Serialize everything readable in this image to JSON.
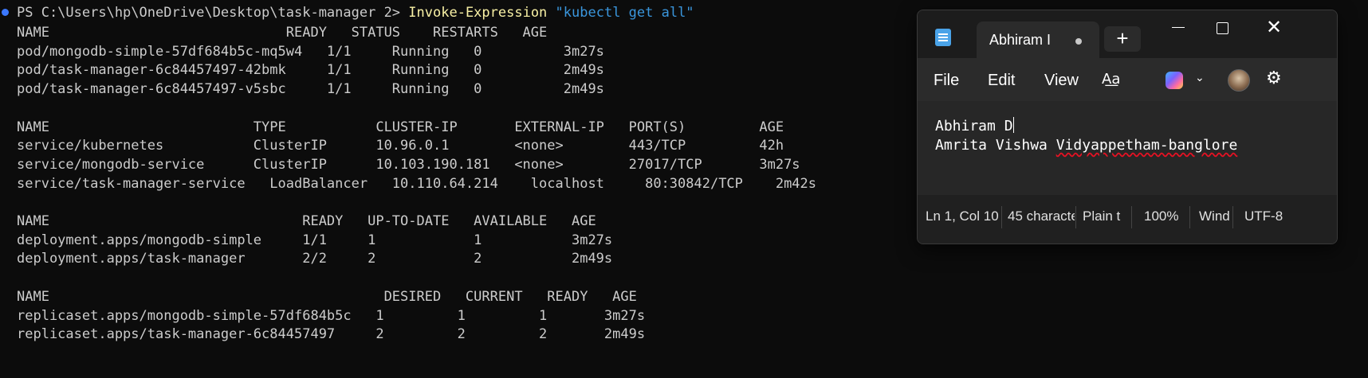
{
  "terminal": {
    "prompt": "PS C:\\Users\\hp\\OneDrive\\Desktop\\task-manager 2>",
    "command": "Invoke-Expression",
    "argument": "\"kubectl get all\"",
    "lines": [
      "NAME                             READY   STATUS    RESTARTS   AGE",
      "pod/mongodb-simple-57df684b5c-mq5w4   1/1     Running   0          3m27s",
      "pod/task-manager-6c84457497-42bmk     1/1     Running   0          2m49s",
      "pod/task-manager-6c84457497-v5sbc     1/1     Running   0          2m49s",
      "",
      "NAME                         TYPE           CLUSTER-IP       EXTERNAL-IP   PORT(S)         AGE",
      "service/kubernetes           ClusterIP      10.96.0.1        <none>        443/TCP         42h",
      "service/mongodb-service      ClusterIP      10.103.190.181   <none>        27017/TCP       3m27s",
      "service/task-manager-service   LoadBalancer   10.110.64.214    localhost     80:30842/TCP    2m42s",
      "",
      "NAME                               READY   UP-TO-DATE   AVAILABLE   AGE",
      "deployment.apps/mongodb-simple     1/1     1            1           3m27s",
      "deployment.apps/task-manager       2/2     2            2           2m49s",
      "",
      "NAME                                         DESIRED   CURRENT   READY   AGE",
      "replicaset.apps/mongodb-simple-57df684b5c   1         1         1       3m27s",
      "replicaset.apps/task-manager-6c84457497     2         2         2       2m49s"
    ]
  },
  "notepad": {
    "tab_title": "Abhiram I",
    "new_tab": "+",
    "menu": {
      "file": "File",
      "edit": "Edit",
      "view": "View"
    },
    "content": {
      "line1": "Abhiram D",
      "line2_prefix": "Amrita Vishwa ",
      "line2_misspelled": "Vidyappetham-banglore"
    },
    "status": {
      "position": "Ln 1, Col 10",
      "chars": "45 characte",
      "format": "Plain t",
      "zoom": "100%",
      "line_ending": "Wind",
      "encoding": "UTF-8"
    },
    "colors": {
      "title_bg": "#1c1c1c",
      "menu_bg": "#2b2b2b",
      "editor_bg": "#272727",
      "spell_underline": "#e81123"
    }
  }
}
